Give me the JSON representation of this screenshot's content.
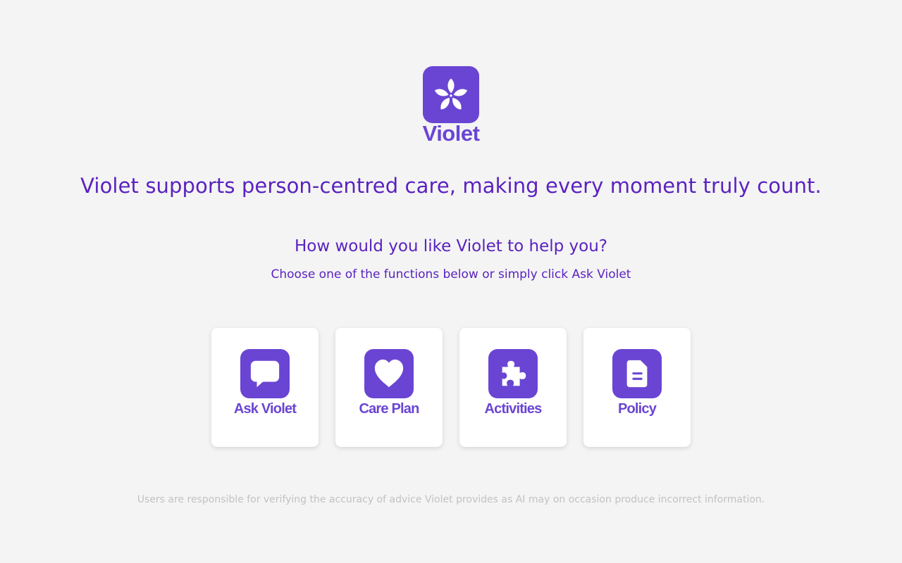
{
  "header": {
    "brand_name": "Violet",
    "logo_icon": "flower-icon"
  },
  "hero": {
    "tagline": "Violet supports person-centred care, making every moment truly count.",
    "question": "How would you like Violet to help you?",
    "subtitle": "Choose one of the functions below or simply click Ask Violet"
  },
  "functions": [
    {
      "label": "Ask Violet",
      "icon": "chat-bubble-icon"
    },
    {
      "label": "Care Plan",
      "icon": "heart-icon"
    },
    {
      "label": "Activities",
      "icon": "puzzle-piece-icon"
    },
    {
      "label": "Policy",
      "icon": "document-icon"
    }
  ],
  "footer": {
    "disclaimer": "Users are responsible for verifying the accuracy of advice Violet provides as AI may on occasion produce incorrect information."
  },
  "colors": {
    "brand": "#6a45d3",
    "text_accent": "#5a22c0",
    "background": "#f4f4f4",
    "muted": "#c2c2c2"
  }
}
